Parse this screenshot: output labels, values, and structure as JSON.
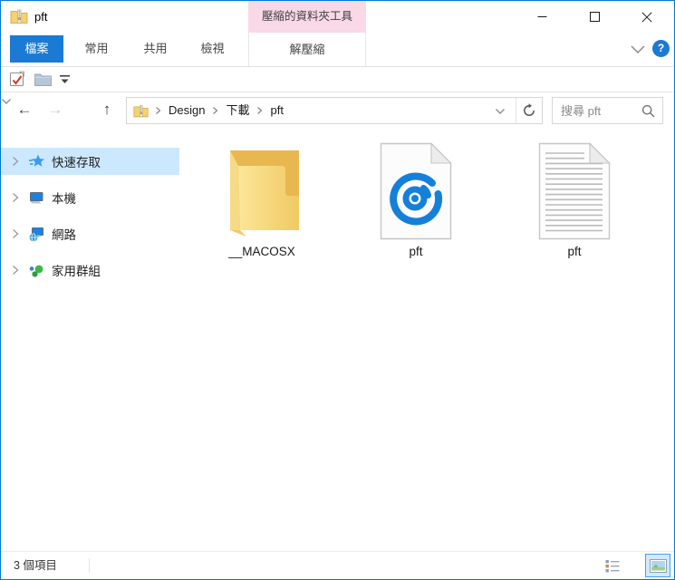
{
  "window": {
    "title": "pft"
  },
  "titlebar": {
    "contextual_group_label": "壓縮的資料夾工具"
  },
  "ribbon": {
    "tab_file": "檔案",
    "tab_home": "常用",
    "tab_share": "共用",
    "tab_view": "檢視",
    "tab_extract": "解壓縮",
    "help_glyph": "?"
  },
  "navbar": {
    "back_glyph": "←",
    "forward_glyph": "→",
    "up_glyph": "↑",
    "breadcrumb": [
      "Design",
      "下載",
      "pft"
    ],
    "search_placeholder": "搜尋 pft"
  },
  "sidebar": {
    "items": [
      {
        "label": "快速存取",
        "selected": true
      },
      {
        "label": "本機",
        "selected": false
      },
      {
        "label": "網路",
        "selected": false
      },
      {
        "label": "家用群組",
        "selected": false
      }
    ]
  },
  "content": {
    "items": [
      {
        "label": "__MACOSX",
        "type": "folder"
      },
      {
        "label": "pft",
        "type": "disc-image-file"
      },
      {
        "label": "pft",
        "type": "document-file"
      }
    ]
  },
  "statusbar": {
    "item_count": "3 個項目"
  },
  "colors": {
    "accent_blue": "#1a7ad4",
    "contextual_pink": "#f9d8e8",
    "selection_blue": "#cce8ff",
    "folder_yellow": "#f2cb64",
    "disc_blue": "#1480da",
    "window_border": "#0078d7"
  }
}
